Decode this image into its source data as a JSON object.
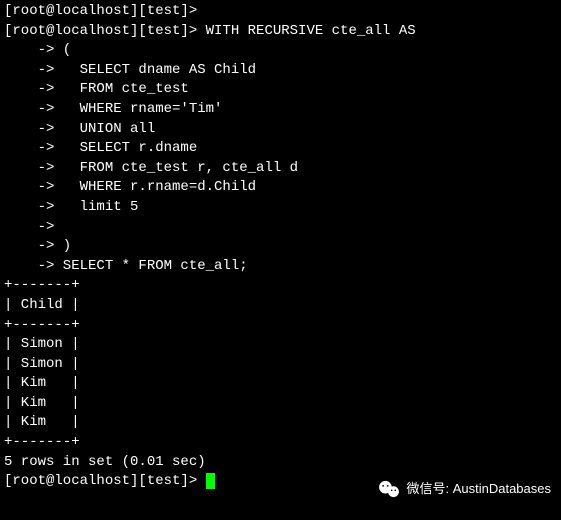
{
  "terminal": {
    "prompt_line_0": "[root@localhost][test]>",
    "prompt_line_1": "[root@localhost][test]> WITH RECURSIVE cte_all AS",
    "continuation_lines": [
      "    -> (",
      "    ->   SELECT dname AS Child",
      "    ->   FROM cte_test",
      "    ->   WHERE rname='Tim'",
      "    ->   UNION all",
      "    ->   SELECT r.dname",
      "    ->   FROM cte_test r, cte_all d",
      "    ->   WHERE r.rname=d.Child",
      "    ->   limit 5",
      "    ->",
      "    -> )",
      "    -> SELECT * FROM cte_all;"
    ],
    "table_border": "+-------+",
    "table_header": "| Child |",
    "table_rows": [
      "| Simon |",
      "| Simon |",
      "| Kim   |",
      "| Kim   |",
      "| Kim   |"
    ],
    "result_summary": "5 rows in set (0.01 sec)",
    "blank": "",
    "prompt_final": "[root@localhost][test]> "
  },
  "watermark": {
    "label": "微信号: AustinDatabases"
  }
}
